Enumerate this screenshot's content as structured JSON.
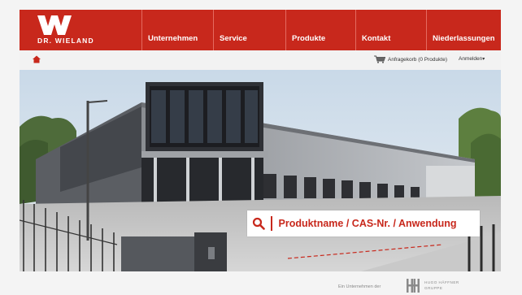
{
  "brand": {
    "name": "DR. WIELAND",
    "accent_color": "#c8281c"
  },
  "nav": {
    "items": [
      {
        "label": "Unternehmen"
      },
      {
        "label": "Service"
      },
      {
        "label": "Produkte"
      },
      {
        "label": "Kontakt"
      },
      {
        "label": "Niederlassungen"
      }
    ]
  },
  "utility": {
    "home_icon": "home-icon",
    "cart_icon": "shopping-cart-icon",
    "cart_label": "Anfragekorb (0 Produkte)",
    "login_label": "Anmelden"
  },
  "search": {
    "placeholder": "Produktname / CAS-Nr. / Anwendung",
    "icon": "search-icon"
  },
  "footer": {
    "text": "Ein Unternehmen der",
    "partner_line1": "HUGO HÄFFNER",
    "partner_line2": "GRUPPE"
  }
}
